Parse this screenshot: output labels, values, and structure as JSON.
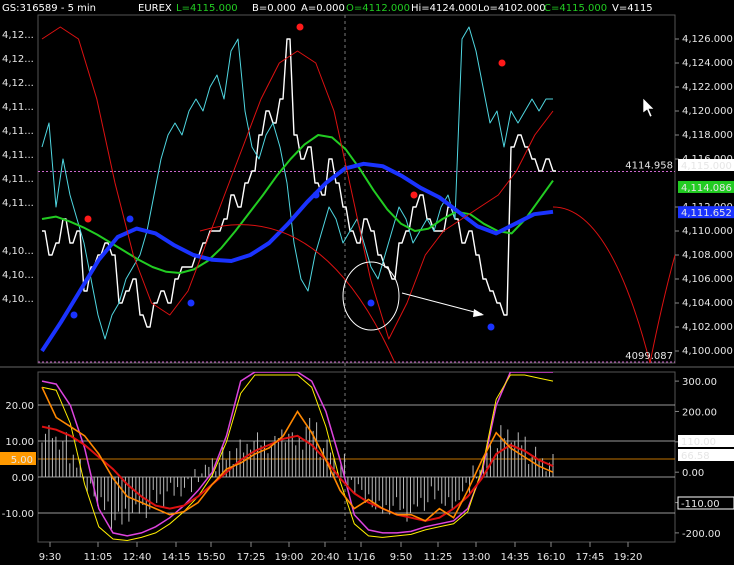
{
  "header": {
    "symbol": "GS:316589 - 5 min",
    "exchange": "EUREX",
    "last": "L=4115.000",
    "bid": "B=0.000",
    "ask": "A=0.000",
    "open": "O=4112.000",
    "high": "Hi=4124.000",
    "low": "Lo=4102.000",
    "close": "C=4115.000",
    "volume": "V=4115"
  },
  "colors": {
    "price": "#ffffff",
    "cyan": "#4fd6e0",
    "ma_green": "#22cc22",
    "ma_blue": "#1a33ff",
    "red": "#dd1111",
    "orange": "#ff8800",
    "yellow": "#ffee00",
    "magenta": "#dd44dd",
    "guide": "#cc66cc",
    "grid": "#333333"
  },
  "chart_data": [
    {
      "type": "line",
      "panel": "price",
      "ylim": [
        4099,
        4128
      ],
      "ticks_right": [
        "4,126.000",
        "4,124.000",
        "4,122.000",
        "4,120.000",
        "4,118.000",
        "4,116.000",
        "4,112.000",
        "4,110.000",
        "4,108.000",
        "4,106.000",
        "4,104.000",
        "4,102.000",
        "4,100.000"
      ],
      "ticks_left": [
        "4,12...",
        "4,12...",
        "4,12...",
        "4,11...",
        "4,11...",
        "4,11...",
        "4,11...",
        "4,11...",
        "4,10...",
        "4,10...",
        "4,10..."
      ],
      "levels": [
        {
          "value": 4114.958,
          "label": "4114.958"
        },
        {
          "value": 4099.087,
          "label": "4099.087"
        }
      ],
      "last_value_boxes": [
        {
          "value": 4115.0,
          "label": "4,115.000"
        },
        {
          "value": 4114.086,
          "label": "4,114.086"
        },
        {
          "value": 4111.652,
          "label": "4,111.652"
        }
      ],
      "series": [
        {
          "key": "price",
          "values": [
            4110,
            4108,
            4109,
            4111,
            4109,
            4110,
            4105,
            4107,
            4108,
            4109,
            4108,
            4104,
            4105,
            4106,
            4103,
            4102,
            4104,
            4105,
            4104,
            4106,
            4107,
            4107,
            4108,
            4109,
            4110,
            4110,
            4111,
            4113,
            4112,
            4114,
            4115,
            4118,
            4120,
            4119,
            4121,
            4126,
            4118,
            4116,
            4117,
            4114,
            4113,
            4116,
            4114,
            4112,
            4110,
            4109,
            4111,
            4110,
            4108,
            4107,
            4106,
            4109,
            4110,
            4112,
            4113,
            4111,
            4110,
            4110,
            4112,
            4111,
            4109,
            4110,
            4108,
            4106,
            4105,
            4104,
            4103,
            4117,
            4118,
            4117,
            4116,
            4115,
            4116,
            4115
          ]
        },
        {
          "key": "cyan",
          "values": [
            4117,
            4119,
            4112,
            4116,
            4113,
            4111,
            4109,
            4106,
            4103,
            4101,
            4103,
            4104,
            4106,
            4107,
            4108,
            4110,
            4113,
            4116,
            4118,
            4119,
            4118,
            4120,
            4121,
            4120,
            4122,
            4123,
            4121,
            4125,
            4126,
            4120,
            4117,
            4116,
            4118,
            4119,
            4117,
            4114,
            4109,
            4106,
            4105,
            4108,
            4110,
            4112,
            4111,
            4109,
            4110,
            4111,
            4109,
            4107,
            4106,
            4108,
            4110,
            4112,
            4111,
            4109,
            4110,
            4111,
            4110,
            4112,
            4113,
            4111,
            4126,
            4127,
            4125,
            4122,
            4119,
            4120,
            4117,
            4120,
            4119,
            4120,
            4121,
            4120,
            4121,
            4121
          ]
        },
        {
          "key": "green",
          "values": [
            4111,
            4111.2,
            4110.8,
            4110.3,
            4109.7,
            4109.0,
            4108.3,
            4107.6,
            4107.0,
            4106.6,
            4106.5,
            4106.8,
            4107.5,
            4108.6,
            4110.0,
            4111.5,
            4113.0,
            4114.6,
            4116.0,
            4117.2,
            4118.0,
            4117.8,
            4116.8,
            4115.2,
            4113.4,
            4111.8,
            4110.6,
            4110.0,
            4110.2,
            4111.0,
            4111.6,
            4111.4,
            4110.6,
            4110.0,
            4109.8,
            4111.0,
            4112.6,
            4114.2
          ]
        },
        {
          "key": "blue",
          "values": [
            4100.0,
            4102.4,
            4105.0,
            4107.6,
            4109.5,
            4110.2,
            4109.8,
            4108.8,
            4108.0,
            4107.6,
            4107.5,
            4108.0,
            4109.0,
            4110.6,
            4112.4,
            4114.0,
            4115.2,
            4115.6,
            4115.4,
            4114.6,
            4113.6,
            4112.8,
            4111.6,
            4110.4,
            4109.8,
            4110.6,
            4111.4,
            4111.6
          ]
        },
        {
          "key": "red",
          "values": [
            4126,
            4127,
            4126,
            4121,
            4114,
            4108,
            4104,
            4103,
            4105,
            4109,
            4113,
            4117,
            4121,
            4124,
            4125,
            4124,
            4120,
            4113,
            4106,
            4101,
            4104,
            4108,
            4110,
            4111,
            4112,
            4113,
            4115,
            4118,
            4120
          ]
        }
      ],
      "markers_red": [
        4111,
        4127,
        4113,
        4124
      ],
      "markers_blue": [
        4103,
        4104,
        4113,
        4104,
        4102,
        4111
      ]
    },
    {
      "type": "line",
      "panel": "oscillator",
      "ylim": [
        -230,
        330
      ],
      "ticks_left": [
        "20.00",
        "10.00",
        "0.00",
        "-10.00"
      ],
      "ticks_right": [
        "300.00",
        "200.00",
        "100.00",
        "0.00",
        "-100.00",
        "-200.00"
      ],
      "levels_left": [
        20,
        10,
        5,
        0,
        -10
      ],
      "last_value_boxes": [
        {
          "value": 110,
          "label": "110.00"
        },
        {
          "value": 66.58,
          "label": "66.58"
        },
        {
          "value": -110,
          "label": "-110.00"
        }
      ],
      "left_box": {
        "value": 5,
        "label": "5.00"
      },
      "series": [
        {
          "key": "magenta",
          "values": [
            300,
            290,
            220,
            80,
            -120,
            -200,
            -210,
            -200,
            -180,
            -150,
            -110,
            -60,
            0,
            120,
            300,
            330,
            330,
            330,
            330,
            300,
            200,
            40,
            -140,
            -190,
            -200,
            -200,
            -195,
            -180,
            -170,
            -160,
            -120,
            0,
            220,
            330,
            330,
            330,
            330
          ]
        },
        {
          "key": "yellow_osc",
          "values": [
            280,
            270,
            160,
            -40,
            -180,
            -220,
            -225,
            -215,
            -200,
            -170,
            -130,
            -80,
            -10,
            100,
            260,
            320,
            320,
            320,
            320,
            280,
            150,
            -30,
            -170,
            -210,
            -215,
            -210,
            -205,
            -190,
            -180,
            -170,
            -130,
            10,
            240,
            320,
            320,
            310,
            300
          ]
        },
        {
          "key": "red_osc",
          "values": [
            150,
            140,
            120,
            90,
            50,
            10,
            -40,
            -80,
            -110,
            -120,
            -110,
            -80,
            -40,
            0,
            40,
            70,
            90,
            110,
            120,
            90,
            40,
            -20,
            -70,
            -100,
            -120,
            -140,
            -150,
            -160,
            -150,
            -120,
            -80,
            -20,
            60,
            90,
            70,
            40,
            20
          ]
        },
        {
          "key": "orange_osc",
          "values": [
            280,
            180,
            150,
            120,
            60,
            -20,
            -80,
            -100,
            -120,
            -140,
            -130,
            -100,
            -40,
            10,
            30,
            60,
            80,
            120,
            200,
            130,
            40,
            -60,
            -120,
            -90,
            -120,
            -140,
            -140,
            -160,
            -120,
            -150,
            -60,
            40,
            130,
            80,
            50,
            20,
            0
          ]
        }
      ],
      "histogram": [
        12,
        10,
        5,
        -3,
        -8,
        -12,
        -10,
        -9,
        -6,
        -4,
        -3,
        1,
        4,
        6,
        8,
        10,
        9,
        12,
        10,
        14,
        8,
        4,
        -2,
        -6,
        -9,
        -8,
        -10,
        -7,
        -5,
        -8,
        -4,
        2,
        8,
        12,
        10,
        6,
        4
      ]
    }
  ],
  "x_axis": {
    "ticks": [
      "9:30",
      "11:05",
      "12:40",
      "14:15",
      "15:50",
      "17:25",
      "19:00",
      "20:40",
      "11/16",
      "9:50",
      "11:25",
      "13:00",
      "14:35",
      "16:10",
      "17:45",
      "19:20"
    ]
  }
}
